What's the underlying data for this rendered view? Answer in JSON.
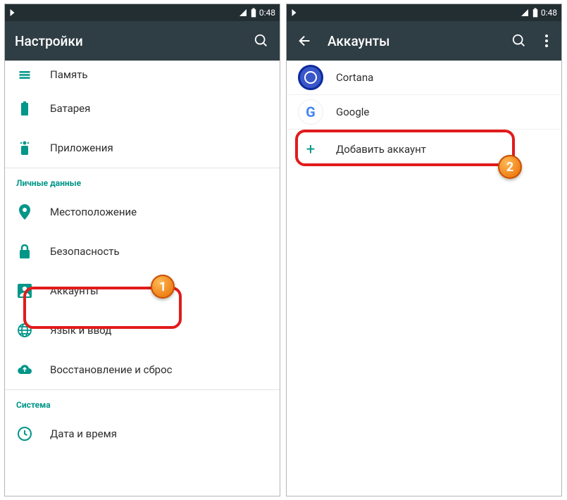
{
  "status": {
    "time": "0:48"
  },
  "left": {
    "title": "Настройки",
    "items": {
      "memory": "Память",
      "battery": "Батарея",
      "apps": "Приложения",
      "location": "Местоположение",
      "security": "Безопасность",
      "accounts": "Аккаунты",
      "language": "Язык и ввод",
      "backup": "Восстановление и сброс",
      "datetime": "Дата и время"
    },
    "sections": {
      "personal": "Личные данные",
      "system": "Система"
    }
  },
  "right": {
    "title": "Аккаунты",
    "items": {
      "cortana": "Cortana",
      "google": "Google",
      "add": "Добавить аккаунт"
    }
  },
  "annotations": {
    "badge1": "1",
    "badge2": "2"
  }
}
